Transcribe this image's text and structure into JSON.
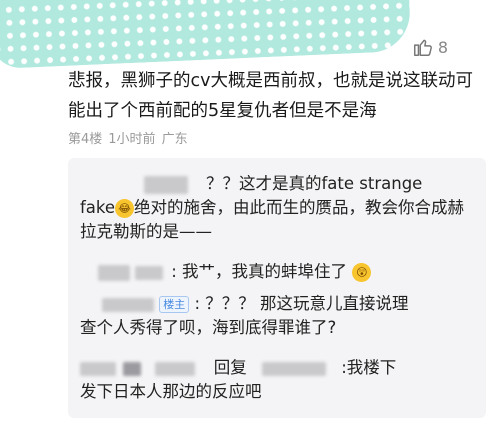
{
  "like": {
    "icon": "thumbs-up-icon",
    "count": "8"
  },
  "comment": {
    "text": "悲报，黑狮子的cv大概是西前叔，也就是说这联动可能出了个西前配的5星复仇者但是不是海",
    "floor": "第4楼",
    "time": "1小时前",
    "location": "广东"
  },
  "replies": [
    {
      "text_a": "？？这才是真的fate strange",
      "text_b": "fake",
      "text_c": "绝对的施舍，由此而生的赝品，教会你合成赫拉克勒斯的是——"
    },
    {
      "text": ": 我艹，我真的蚌埠住了"
    },
    {
      "badge": "楼主",
      "text_a": ": ？？？ 那这玩意儿直接说理",
      "text_b": "查个人秀得了呗，海到底得罪谁了?"
    },
    {
      "reply_word": "回复",
      "text_a": ":我楼下",
      "text_b": "发下日本人那边的反应吧"
    }
  ],
  "colors": {
    "tape": "#aee8dd",
    "badge": "#4a8be0",
    "reply_bg": "#f4f4f6"
  }
}
